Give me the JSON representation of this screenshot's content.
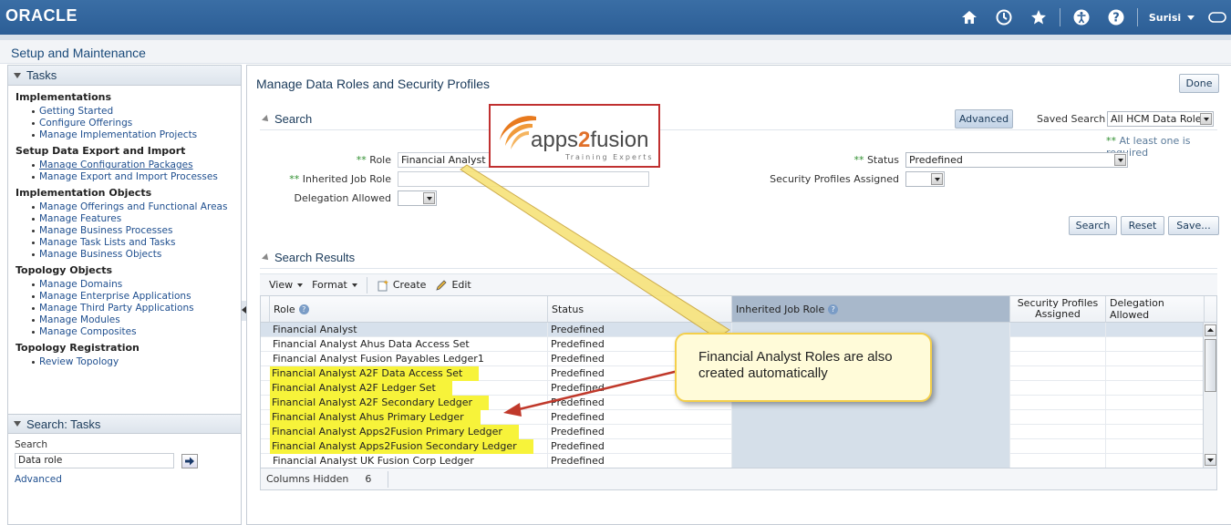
{
  "header": {
    "brand": "ORACLE",
    "user_name": "Surisi",
    "icons": [
      "home-icon",
      "recent-icon",
      "favorites-star-icon",
      "accessibility-icon",
      "help-icon",
      "signout-icon"
    ]
  },
  "page_title": "Setup and Maintenance",
  "tasks_panel": {
    "title": "Tasks",
    "groups": [
      {
        "title": "Implementations",
        "items": [
          "Getting Started",
          "Configure Offerings",
          "Manage Implementation Projects"
        ]
      },
      {
        "title": "Setup Data Export and Import",
        "items": [
          "Manage Configuration Packages",
          "Manage Export and Import Processes"
        ]
      },
      {
        "title": "Implementation Objects",
        "items": [
          "Manage Offerings and Functional Areas",
          "Manage Features",
          "Manage Business Processes",
          "Manage Task Lists and Tasks",
          "Manage Business Objects"
        ]
      },
      {
        "title": "Topology Objects",
        "items": [
          "Manage Domains",
          "Manage Enterprise Applications",
          "Manage Third Party Applications",
          "Manage Modules",
          "Manage Composites"
        ]
      },
      {
        "title": "Topology Registration",
        "items": [
          "Review Topology"
        ]
      }
    ]
  },
  "search_tasks": {
    "title": "Search: Tasks",
    "label": "Search",
    "value": "Data role",
    "advanced": "Advanced"
  },
  "main": {
    "title": "Manage Data Roles and Security Profiles",
    "done": "Done",
    "search": {
      "title": "Search",
      "advanced_button": "Advanced",
      "saved_search_label": "Saved Search",
      "saved_search_value": "All HCM Data Roles",
      "required_star": "**",
      "required_note": "At least one is required",
      "role_label": "Role",
      "role_value": "Financial Analyst",
      "inherited_job_role_label": "Inherited Job Role",
      "inherited_job_role_value": "",
      "delegation_allowed_label": "Delegation Allowed",
      "status_label": "Status",
      "status_value": "Predefined",
      "security_profiles_assigned_label": "Security Profiles Assigned",
      "buttons": {
        "search": "Search",
        "reset": "Reset",
        "save": "Save..."
      }
    },
    "results": {
      "title": "Search Results",
      "toolbar": {
        "view": "View",
        "format": "Format",
        "create": "Create",
        "edit": "Edit"
      },
      "columns": [
        "Role",
        "Status",
        "Inherited Job Role",
        "Security Profiles Assigned",
        "Delegation Allowed"
      ],
      "rows": [
        {
          "role": "Financial Analyst",
          "status": "Predefined",
          "highlight": false,
          "selected": true
        },
        {
          "role": "Financial Analyst Ahus Data Access Set",
          "status": "Predefined",
          "highlight": false,
          "selected": false
        },
        {
          "role": "Financial Analyst Fusion Payables Ledger1",
          "status": "Predefined",
          "highlight": false,
          "selected": false
        },
        {
          "role": "Financial Analyst A2F Data Access Set",
          "status": "Predefined",
          "highlight": true,
          "selected": false
        },
        {
          "role": "Financial Analyst A2F Ledger Set",
          "status": "Predefined",
          "highlight": true,
          "selected": false
        },
        {
          "role": "Financial Analyst A2F Secondary Ledger",
          "status": "Predefined",
          "highlight": true,
          "selected": false
        },
        {
          "role": "Financial Analyst Ahus Primary Ledger",
          "status": "Predefined",
          "highlight": true,
          "selected": false
        },
        {
          "role": "Financial Analyst Apps2Fusion Primary Ledger",
          "status": "Predefined",
          "highlight": true,
          "selected": false
        },
        {
          "role": "Financial Analyst Apps2Fusion Secondary Ledger",
          "status": "Predefined",
          "highlight": true,
          "selected": false
        },
        {
          "role": "Financial Analyst UK Fusion Corp Ledger",
          "status": "Predefined",
          "highlight": false,
          "selected": false
        }
      ],
      "columns_hidden_label": "Columns Hidden",
      "columns_hidden_count": "6"
    }
  },
  "overlay": {
    "logo_prefix": "apps",
    "logo_number": "2",
    "logo_suffix": "fusion",
    "logo_tagline": "Training Experts",
    "callout_text": "Financial Analyst Roles are also created automatically"
  },
  "colors": {
    "header_blue": "#2c5e96",
    "highlight_yellow": "#f7f33a",
    "callout_border": "#f4cf4a",
    "arrow_red": "#c0392b",
    "logo_box_border": "#c03030"
  }
}
